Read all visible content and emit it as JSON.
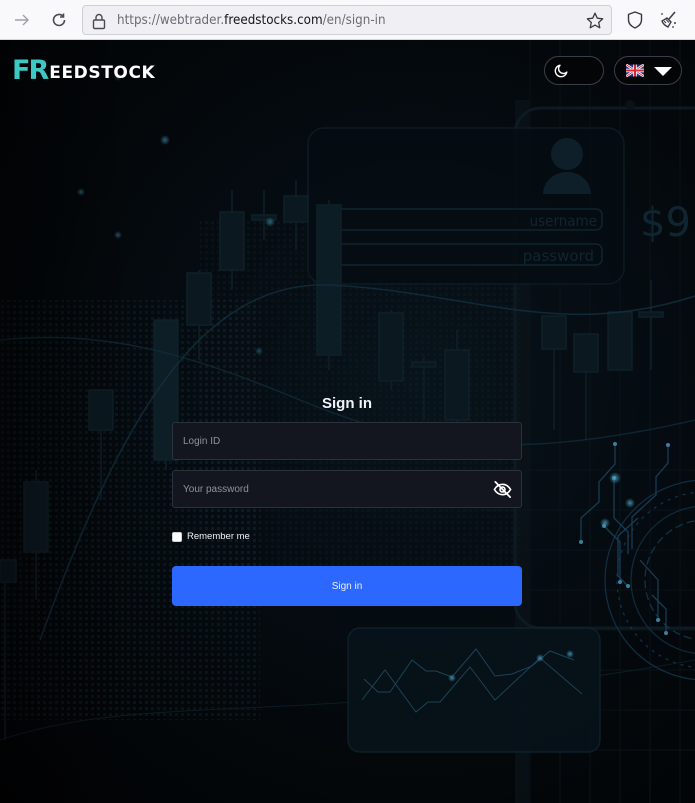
{
  "browser": {
    "url_scheme": "https://",
    "url_subdomain": "webtrader.",
    "url_host": "freedstocks.com",
    "url_path": "/en/sign-in",
    "icons": {
      "forward": "arrow-right-icon",
      "reload": "reload-icon",
      "lock": "lock-icon",
      "bookmark": "star-icon",
      "tracking": "shield-icon",
      "extension": "broom-icon"
    }
  },
  "header": {
    "logo_mark": "FR",
    "logo_word": "EEDSTOCK",
    "theme_toggle_icon": "moon-icon",
    "language": {
      "selected_flag": "uk-flag-icon",
      "dropdown_icon": "caret-down-icon"
    }
  },
  "background": {
    "decor_username_label": "username",
    "decor_password_label": "password",
    "decor_price_text": "$9"
  },
  "signin": {
    "title": "Sign in",
    "login_id": {
      "value": "",
      "placeholder": "Login ID"
    },
    "password": {
      "value": "",
      "placeholder": "Your password",
      "toggle_icon": "eye-slash-icon"
    },
    "remember_me": {
      "label": "Remember me",
      "checked": false
    },
    "submit_label": "Sign in"
  },
  "colors": {
    "brand_teal": "#3cc9c4",
    "primary_button": "#2d68fe",
    "input_bg": "#13161e",
    "page_bg": "#020406"
  }
}
